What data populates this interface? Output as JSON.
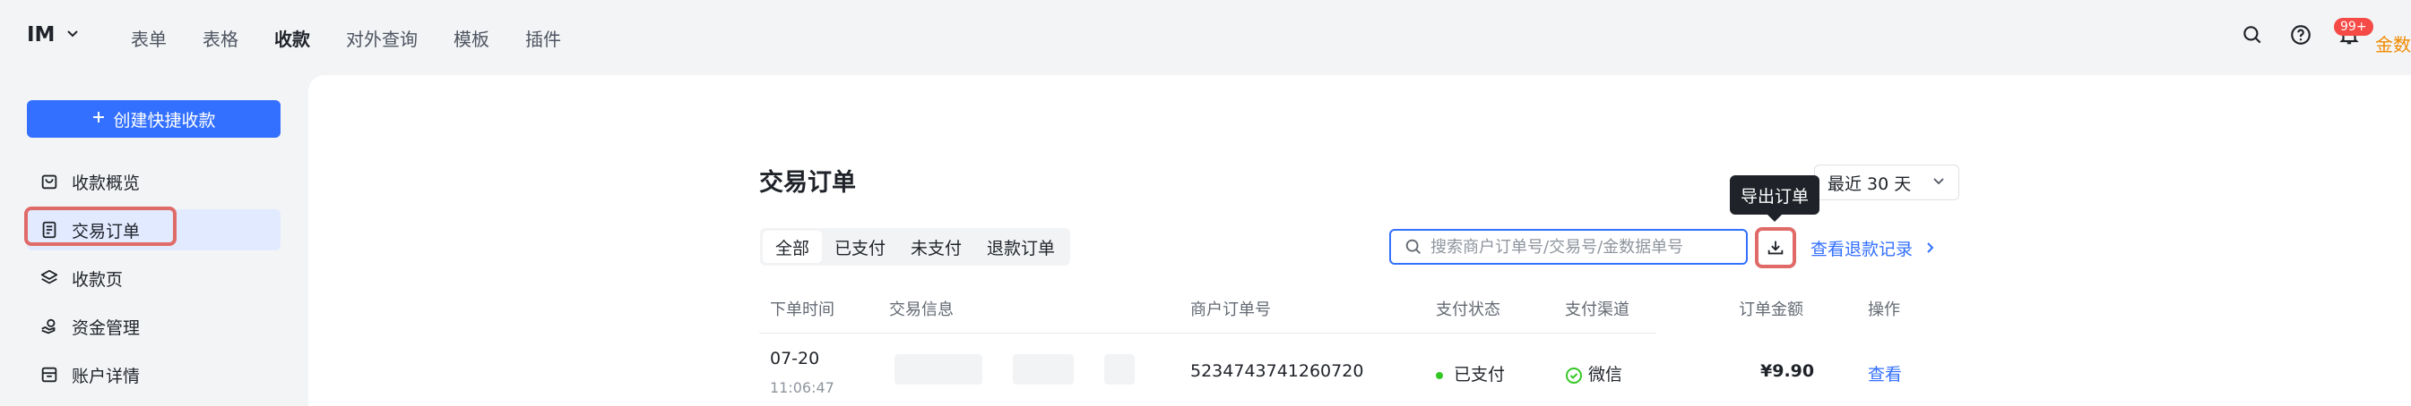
{
  "header": {
    "brand": "IM",
    "nav": [
      "表单",
      "表格",
      "收款",
      "对外查询",
      "模板",
      "插件"
    ],
    "active_nav": "收款",
    "notification_badge": "99+",
    "avatar_text": "金数"
  },
  "sidebar": {
    "create_button": "创建快捷收款",
    "items": [
      {
        "label": "收款概览",
        "icon": "bag-icon"
      },
      {
        "label": "交易订单",
        "icon": "document-icon",
        "active": true
      },
      {
        "label": "收款页",
        "icon": "layers-icon"
      },
      {
        "label": "资金管理",
        "icon": "money-hand-icon"
      },
      {
        "label": "账户详情",
        "icon": "archive-icon"
      }
    ]
  },
  "main": {
    "title": "交易订单",
    "date_range": "最近 30 天",
    "tabs": [
      "全部",
      "已支付",
      "未支付",
      "退款订单"
    ],
    "active_tab": "全部",
    "search_placeholder": "搜索商户订单号/交易号/金数据单号",
    "export_tooltip": "导出订单",
    "refund_link": "查看退款记录",
    "columns": [
      "下单时间",
      "交易信息",
      "商户订单号",
      "支付状态",
      "支付渠道",
      "订单金额",
      "操作"
    ],
    "rows": [
      {
        "date": "07-20",
        "time": "11:06:47",
        "merchant_order_no": "5234743741260720",
        "status": "已支付",
        "channel": "微信",
        "amount": "¥9.90",
        "action": "查看"
      }
    ]
  },
  "colors": {
    "primary": "#3370ff",
    "highlight": "#e06a67",
    "paid": "#34c724",
    "wechat": "#34c724"
  }
}
